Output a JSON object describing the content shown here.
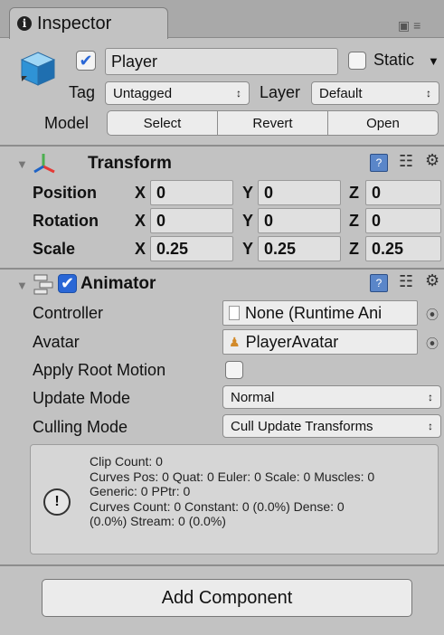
{
  "tab": {
    "title": "Inspector",
    "info_glyph": "i",
    "lock_glyph": "▣ ≡"
  },
  "object": {
    "name": "Player",
    "active_checked": "✔",
    "static_label": "Static",
    "tag_label": "Tag",
    "tag_value": "Untagged",
    "layer_label": "Layer",
    "layer_value": "Default",
    "model_label": "Model",
    "model_buttons": [
      "Select",
      "Revert",
      "Open"
    ]
  },
  "transform": {
    "title": "Transform",
    "rows": [
      {
        "label": "Position",
        "x": "0",
        "y": "0",
        "z": "0"
      },
      {
        "label": "Rotation",
        "x": "0",
        "y": "0",
        "z": "0"
      },
      {
        "label": "Scale",
        "x": "0.25",
        "y": "0.25",
        "z": "0.25"
      }
    ],
    "axis_x": "X",
    "axis_y": "Y",
    "axis_z": "Z"
  },
  "animator": {
    "title": "Animator",
    "enabled_check": "✔",
    "controller_label": "Controller",
    "controller_value": "None (Runtime Ani",
    "avatar_label": "Avatar",
    "avatar_value": "PlayerAvatar",
    "apply_root_motion_label": "Apply Root Motion",
    "update_mode_label": "Update Mode",
    "update_mode_value": "Normal",
    "culling_mode_label": "Culling Mode",
    "culling_mode_value": "Cull Update Transforms",
    "info_lines": [
      "Clip Count: 0",
      "Curves Pos: 0 Quat: 0 Euler: 0 Scale: 0 Muscles: 0",
      "Generic: 0 PPtr: 0",
      "Curves Count: 0 Constant: 0 (0.0%) Dense: 0",
      "(0.0%) Stream: 0 (0.0%)"
    ],
    "info_icon": "!"
  },
  "add_component_label": "Add Component",
  "icons": {
    "popup_arrow": "↕",
    "dropdown_triangle": "▼",
    "fold_triangle": "▼",
    "help_book": "?",
    "preset": "☷",
    "gear": "⚙",
    "target": "⦿"
  }
}
